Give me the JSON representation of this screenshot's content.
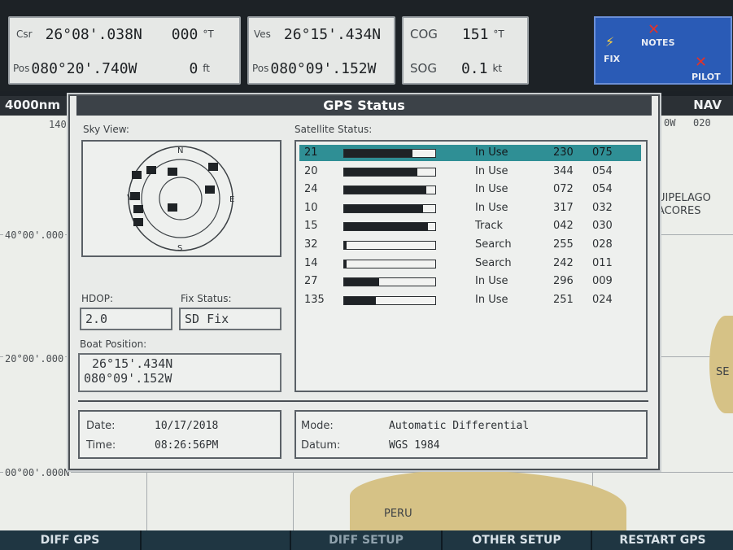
{
  "top": {
    "csr": {
      "label": "Csr",
      "lat": "26°08'.038N",
      "bearing": "000",
      "bearing_unit": "°T"
    },
    "pos": {
      "label": "Pos",
      "lon": "080°20'.740W",
      "depth": "0",
      "depth_unit": "ft"
    },
    "ves": {
      "label": "Ves",
      "lat": "26°15'.434N"
    },
    "vpos": {
      "label": "Pos",
      "lon": "080°09'.152W"
    },
    "cog": {
      "label": "COG",
      "value": "151",
      "unit": "°T"
    },
    "sog": {
      "label": "SOG",
      "value": "0.1",
      "unit": "kt"
    },
    "badges": {
      "fix": "FIX",
      "notes": "NOTES",
      "pilot": "PILOT"
    }
  },
  "chart": {
    "scale": "4000nm",
    "mode": "NAV",
    "coords": [
      "40°00'.000",
      "20°00'.000",
      "00°00'.000N",
      "140",
      "0W",
      "020"
    ],
    "places": [
      "UIPELAGO",
      "ACORES",
      "PERU",
      "SE"
    ]
  },
  "dialog": {
    "title": "GPS Status",
    "sky_view_label": "Sky View:",
    "satellite_status_label": "Satellite Status:",
    "sky": {
      "n": "N",
      "e": "E",
      "s": "S",
      "w": "W"
    },
    "hdop_label": "HDOP:",
    "hdop": "2.0",
    "fix_status_label": "Fix Status:",
    "fix_status": "SD Fix",
    "boat_position_label": "Boat Position:",
    "boat_lat": "26°15'.434N",
    "boat_lon": "080°09'.152W",
    "satellites": [
      {
        "prn": "21",
        "signal": 0.75,
        "status": "In Use",
        "azimuth": "230",
        "elevation": "075"
      },
      {
        "prn": "20",
        "signal": 0.8,
        "status": "In Use",
        "azimuth": "344",
        "elevation": "054"
      },
      {
        "prn": "24",
        "signal": 0.9,
        "status": "In Use",
        "azimuth": "072",
        "elevation": "054"
      },
      {
        "prn": "10",
        "signal": 0.87,
        "status": "In Use",
        "azimuth": "317",
        "elevation": "032"
      },
      {
        "prn": "15",
        "signal": 0.92,
        "status": "Track",
        "azimuth": "042",
        "elevation": "030"
      },
      {
        "prn": "32",
        "signal": 0.03,
        "status": "Search",
        "azimuth": "255",
        "elevation": "028"
      },
      {
        "prn": "14",
        "signal": 0.03,
        "status": "Search",
        "azimuth": "242",
        "elevation": "011"
      },
      {
        "prn": "27",
        "signal": 0.38,
        "status": "In Use",
        "azimuth": "296",
        "elevation": "009"
      },
      {
        "prn": "135",
        "signal": 0.35,
        "status": "In Use",
        "azimuth": "251",
        "elevation": "024"
      }
    ],
    "date_label": "Date:",
    "date": "10/17/2018",
    "time_label": "Time:",
    "time": "08:26:56PM",
    "mode_label": "Mode:",
    "mode": "Automatic Differential",
    "datum_label": "Datum:",
    "datum": "WGS 1984"
  },
  "softkeys": [
    "DIFF GPS",
    "",
    "DIFF SETUP",
    "OTHER SETUP",
    "RESTART GPS"
  ]
}
